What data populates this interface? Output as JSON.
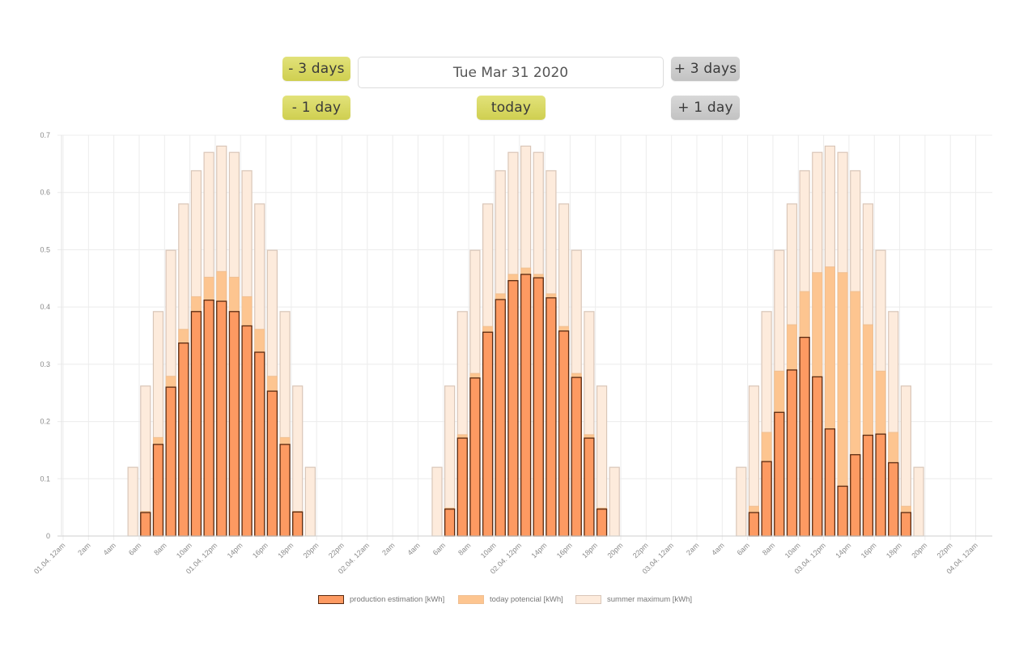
{
  "navigation": {
    "minus_3_days": "- 3 days",
    "plus_3_days": "+ 3 days",
    "minus_1_day": "- 1 day",
    "today": "today",
    "plus_1_day": "+ 1 day",
    "date_value": "Tue Mar 31 2020"
  },
  "colors": {
    "production": "#fd9a62",
    "production_border": "#5a2a10",
    "potential": "#fdc590",
    "potential_border": "#efbf92",
    "summer": "#fdebdc",
    "summer_border": "#d9c6b8",
    "grid": "#ececec",
    "axis_text": "#8a8a8a",
    "button_yellow": "#d8d865",
    "button_gray": "#cdcdcd"
  },
  "chart_data": {
    "type": "bar",
    "stacking": "overlaid",
    "title": "",
    "xlabel": "",
    "ylabel": "",
    "ylim": [
      0,
      0.7
    ],
    "yticks": [
      "0",
      "0.1",
      "0.2",
      "0.3",
      "0.4",
      "0.5",
      "0.6",
      "0.7"
    ],
    "grid": true,
    "legend_position": "bottom",
    "x_range_hours": [
      0,
      72
    ],
    "x_ticks": [
      "01.04. 12am",
      "2am",
      "4am",
      "6am",
      "8am",
      "10am",
      "01.04. 12pm",
      "14pm",
      "16pm",
      "18pm",
      "20pm",
      "22pm",
      "02.04. 12am",
      "2am",
      "4am",
      "6am",
      "8am",
      "10am",
      "02.04. 12pm",
      "14pm",
      "16pm",
      "18pm",
      "20pm",
      "22pm",
      "03.04. 12am",
      "2am",
      "4am",
      "6am",
      "8am",
      "10am",
      "03.04. 12pm",
      "14pm",
      "16pm",
      "18pm",
      "20pm",
      "22pm",
      "04.04. 12am"
    ],
    "hours": [
      5,
      6,
      7,
      8,
      9,
      10,
      11,
      12,
      13,
      14,
      15,
      16,
      17,
      18,
      19
    ],
    "series": [
      {
        "name": "production estimation [kWh]",
        "days": [
          [
            0,
            0.041,
            0.16,
            0.26,
            0.337,
            0.392,
            0.412,
            0.41,
            0.392,
            0.367,
            0.321,
            0.253,
            0.16,
            0.042,
            0
          ],
          [
            0,
            0.047,
            0.171,
            0.276,
            0.356,
            0.413,
            0.446,
            0.457,
            0.451,
            0.416,
            0.358,
            0.277,
            0.171,
            0.047,
            0
          ],
          [
            0,
            0.041,
            0.13,
            0.216,
            0.29,
            0.347,
            0.278,
            0.187,
            0.087,
            0.142,
            0.176,
            0.178,
            0.128,
            0.041,
            0
          ]
        ]
      },
      {
        "name": "today potencial [kWh]",
        "days": [
          [
            0,
            0.043,
            0.172,
            0.279,
            0.361,
            0.418,
            0.452,
            0.462,
            0.452,
            0.418,
            0.361,
            0.279,
            0.172,
            0.043,
            0
          ],
          [
            0,
            0.049,
            0.177,
            0.284,
            0.366,
            0.423,
            0.457,
            0.468,
            0.457,
            0.423,
            0.366,
            0.284,
            0.177,
            0.049,
            0
          ],
          [
            0,
            0.052,
            0.181,
            0.288,
            0.369,
            0.427,
            0.46,
            0.47,
            0.46,
            0.427,
            0.369,
            0.288,
            0.181,
            0.052,
            0
          ]
        ]
      },
      {
        "name": "summer maximum [kWh]",
        "days": [
          [
            0.12,
            0.262,
            0.392,
            0.499,
            0.58,
            0.638,
            0.67,
            0.681,
            0.67,
            0.638,
            0.58,
            0.499,
            0.392,
            0.262,
            0.12
          ],
          [
            0.12,
            0.262,
            0.392,
            0.499,
            0.58,
            0.638,
            0.67,
            0.681,
            0.67,
            0.638,
            0.58,
            0.499,
            0.392,
            0.262,
            0.12
          ],
          [
            0.12,
            0.262,
            0.392,
            0.499,
            0.58,
            0.638,
            0.67,
            0.681,
            0.67,
            0.638,
            0.58,
            0.499,
            0.392,
            0.262,
            0.12
          ]
        ]
      }
    ],
    "legend": [
      "production estimation [kWh]",
      "today potencial [kWh]",
      "summer maximum [kWh]"
    ]
  }
}
